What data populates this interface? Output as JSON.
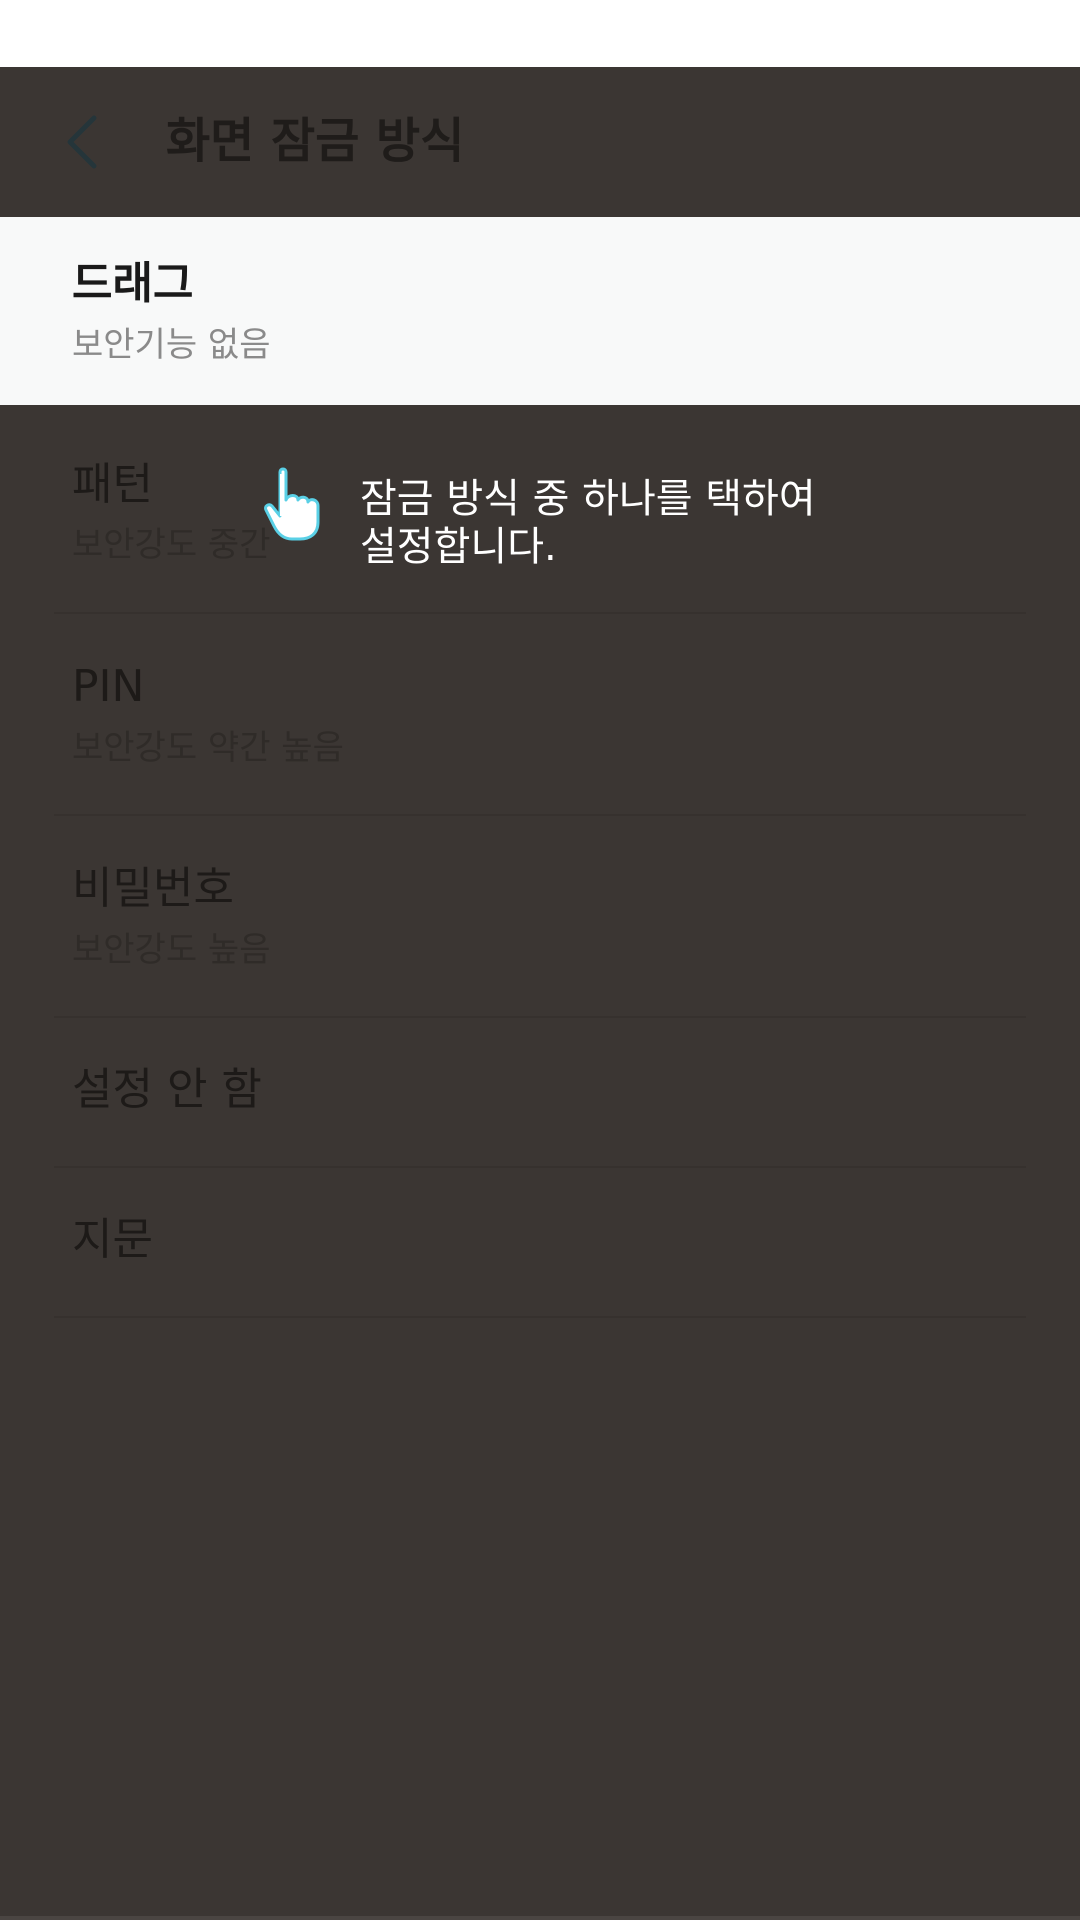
{
  "app_bar": {
    "title": "화면 잠금 방식",
    "back_icon": "chevron-left-icon"
  },
  "lock_options": [
    {
      "title": "드래그",
      "subtitle": "보안기능 없음",
      "highlighted": true
    },
    {
      "title": "패턴",
      "subtitle": "보안강도 중간"
    },
    {
      "title": "PIN",
      "subtitle": "보안강도 약간 높음"
    },
    {
      "title": "비밀번호",
      "subtitle": "보안강도 높음"
    },
    {
      "title": "설정 안 함"
    },
    {
      "title": "지문"
    }
  ],
  "tooltip": {
    "line1": "잠금 방식 중 하나를 택하여",
    "line2": "설정합니다.",
    "icon": "hand-pointer-icon"
  },
  "colors": {
    "overlay": "#3b3633",
    "highlight_bg": "#f8f9f9",
    "status_bar": "#ffffff",
    "tooltip_text": "#ffffff",
    "hand_outline": "#5ad0e6"
  }
}
